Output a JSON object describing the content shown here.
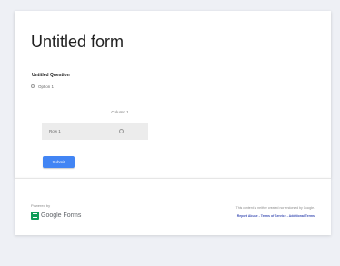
{
  "form": {
    "title": "Untitled form",
    "question_title": "Untitled Question",
    "option_1": "Option 1",
    "grid_column_1": "Column 1",
    "grid_row_1": "Row 1",
    "submit_label": "Submit"
  },
  "footer": {
    "powered_by": "Powered by",
    "brand_google": "Google",
    "brand_forms": "Forms",
    "disclaimer": "This content is neither created nor endorsed by Google.",
    "report_abuse": "Report Abuse",
    "separator_1": " - ",
    "terms": "Terms of Service",
    "separator_2": " - ",
    "additional_terms": "Additional Terms"
  },
  "colors": {
    "accent": "#4285f4",
    "forms_green": "#0f9d58",
    "link": "#3f51b5",
    "background": "#eef0f5"
  },
  "icons": {
    "logo": "google-forms-icon"
  }
}
